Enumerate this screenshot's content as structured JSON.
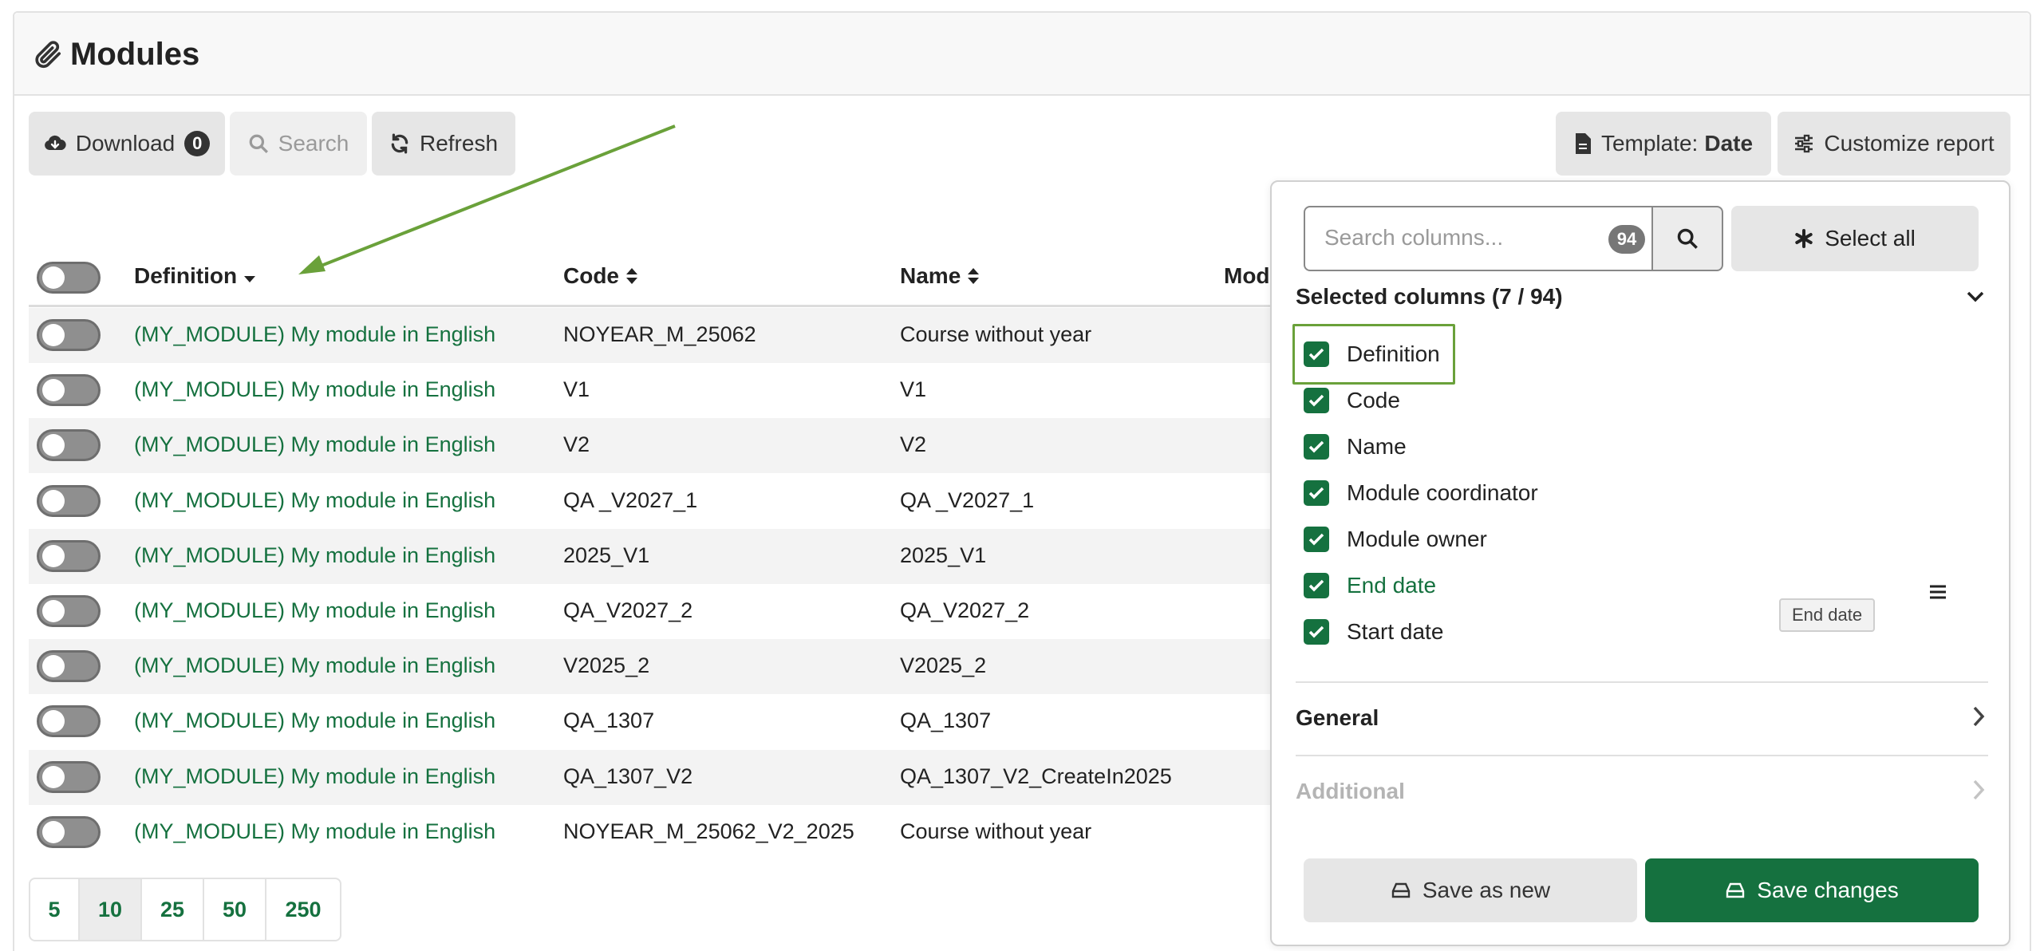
{
  "header": {
    "title": "Modules",
    "icon": "paperclip-icon"
  },
  "toolbar": {
    "download_label": "Download",
    "download_count": "0",
    "search_label": "Search",
    "refresh_label": "Refresh",
    "template_prefix": "Template:",
    "template_value": "Date",
    "customize_label": "Customize report"
  },
  "table": {
    "columns": [
      "Definition",
      "Code",
      "Name",
      "Modu"
    ],
    "rows": [
      {
        "definition": "(MY_MODULE) My module in English",
        "code": "NOYEAR_M_25062",
        "name": "Course without year"
      },
      {
        "definition": "(MY_MODULE) My module in English",
        "code": "V1",
        "name": "V1"
      },
      {
        "definition": "(MY_MODULE) My module in English",
        "code": "V2",
        "name": "V2"
      },
      {
        "definition": "(MY_MODULE) My module in English",
        "code": "QA _V2027_1",
        "name": "QA _V2027_1"
      },
      {
        "definition": "(MY_MODULE) My module in English",
        "code": "2025_V1",
        "name": "2025_V1"
      },
      {
        "definition": "(MY_MODULE) My module in English",
        "code": "QA_V2027_2",
        "name": "QA_V2027_2"
      },
      {
        "definition": "(MY_MODULE) My module in English",
        "code": "V2025_2",
        "name": "V2025_2"
      },
      {
        "definition": "(MY_MODULE) My module in English",
        "code": "QA_1307",
        "name": "QA_1307"
      },
      {
        "definition": "(MY_MODULE) My module in English",
        "code": "QA_1307_V2",
        "name": "QA_1307_V2_CreateIn2025"
      },
      {
        "definition": "(MY_MODULE) My module in English",
        "code": "NOYEAR_M_25062_V2_2025",
        "name": "Course without year"
      }
    ]
  },
  "pager": {
    "sizes": [
      "5",
      "10",
      "25",
      "50",
      "250"
    ],
    "active": "10"
  },
  "panel": {
    "search_placeholder": "Search columns...",
    "column_count": "94",
    "select_all_label": "Select all",
    "selected_title": "Selected columns (7 / 94)",
    "selected_columns": [
      "Definition",
      "Code",
      "Name",
      "Module coordinator",
      "Module owner",
      "End date",
      "Start date"
    ],
    "tooltip": "End date",
    "general_label": "General",
    "additional_label": "Additional",
    "save_new_label": "Save as new",
    "save_changes_label": "Save changes"
  },
  "colors": {
    "accent": "#15713f",
    "annotation": "#6aa13a"
  }
}
